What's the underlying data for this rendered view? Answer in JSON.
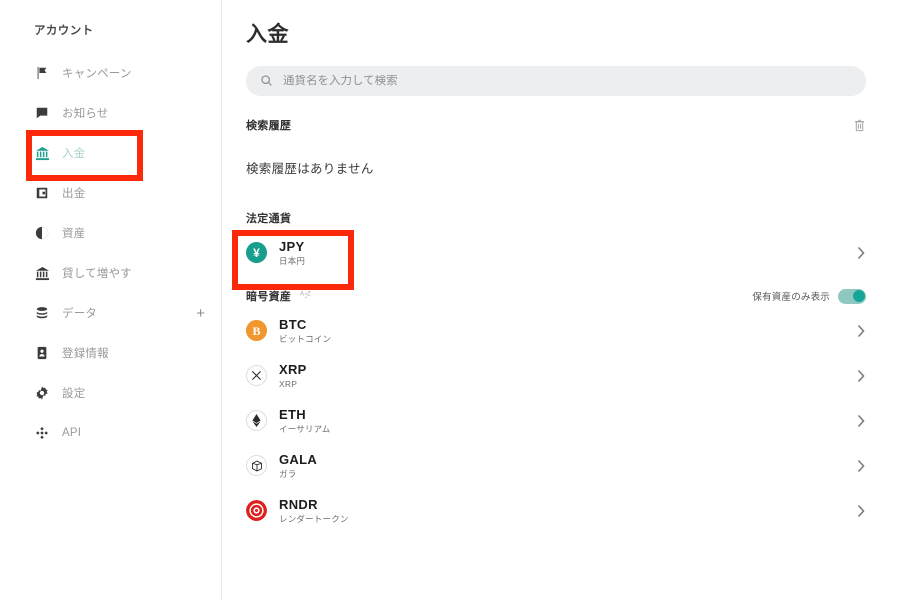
{
  "sidebar": {
    "title": "アカウント",
    "items": [
      {
        "label": "キャンペーン",
        "icon": "flag-icon",
        "active": false
      },
      {
        "label": "お知らせ",
        "icon": "chat-bubble-icon",
        "active": false
      },
      {
        "label": "入金",
        "icon": "bank-icon",
        "active": true
      },
      {
        "label": "出金",
        "icon": "wallet-icon",
        "active": false
      },
      {
        "label": "資産",
        "icon": "pie-chart-icon",
        "active": false
      },
      {
        "label": "貸して増やす",
        "icon": "bank-icon",
        "active": false
      },
      {
        "label": "データ",
        "icon": "database-icon",
        "active": false,
        "trailing": "+"
      },
      {
        "label": "登録情報",
        "icon": "id-card-icon",
        "active": false
      },
      {
        "label": "設定",
        "icon": "gear-icon",
        "active": false
      },
      {
        "label": "API",
        "icon": "api-node-icon",
        "active": false
      }
    ]
  },
  "main": {
    "page_title": "入金",
    "search": {
      "placeholder": "通貨名を入力して検索",
      "value": "",
      "icon": "search-icon"
    },
    "history": {
      "title": "検索履歴",
      "delete_icon": "trash-icon",
      "empty_text": "検索履歴はありません"
    },
    "fiat": {
      "title": "法定通貨",
      "items": [
        {
          "symbol": "JPY",
          "name": "日本円",
          "icon": "yen-coin-icon",
          "color": "#179e8d",
          "chevron": "chevron-right-icon"
        }
      ]
    },
    "crypto": {
      "title": "暗号資産",
      "sort_icon": "sort-az-icon",
      "toggle_label": "保有資産のみ表示",
      "toggle_on": true,
      "items": [
        {
          "symbol": "BTC",
          "name": "ビットコイン",
          "icon": "bitcoin-icon",
          "color": "#f0972e",
          "chevron": "chevron-right-icon"
        },
        {
          "symbol": "XRP",
          "name": "XRP",
          "icon": "xrp-icon",
          "color": "#2b2b2b",
          "chevron": "chevron-right-icon"
        },
        {
          "symbol": "ETH",
          "name": "イーサリアム",
          "icon": "ethereum-icon",
          "color": "#2b2b2b",
          "chevron": "chevron-right-icon"
        },
        {
          "symbol": "GALA",
          "name": "ガラ",
          "icon": "gala-cube-icon",
          "color": "#2b2b2b",
          "chevron": "chevron-right-icon"
        },
        {
          "symbol": "RNDR",
          "name": "レンダートークン",
          "icon": "render-icon",
          "color": "#e01f1f",
          "chevron": "chevron-right-icon"
        }
      ]
    }
  },
  "annotations": {
    "highlight_color": "#fc2a0a",
    "boxes": [
      {
        "name": "deposit-nav-highlight",
        "target": "入金"
      },
      {
        "name": "jpy-row-highlight",
        "target": "JPY"
      }
    ]
  }
}
